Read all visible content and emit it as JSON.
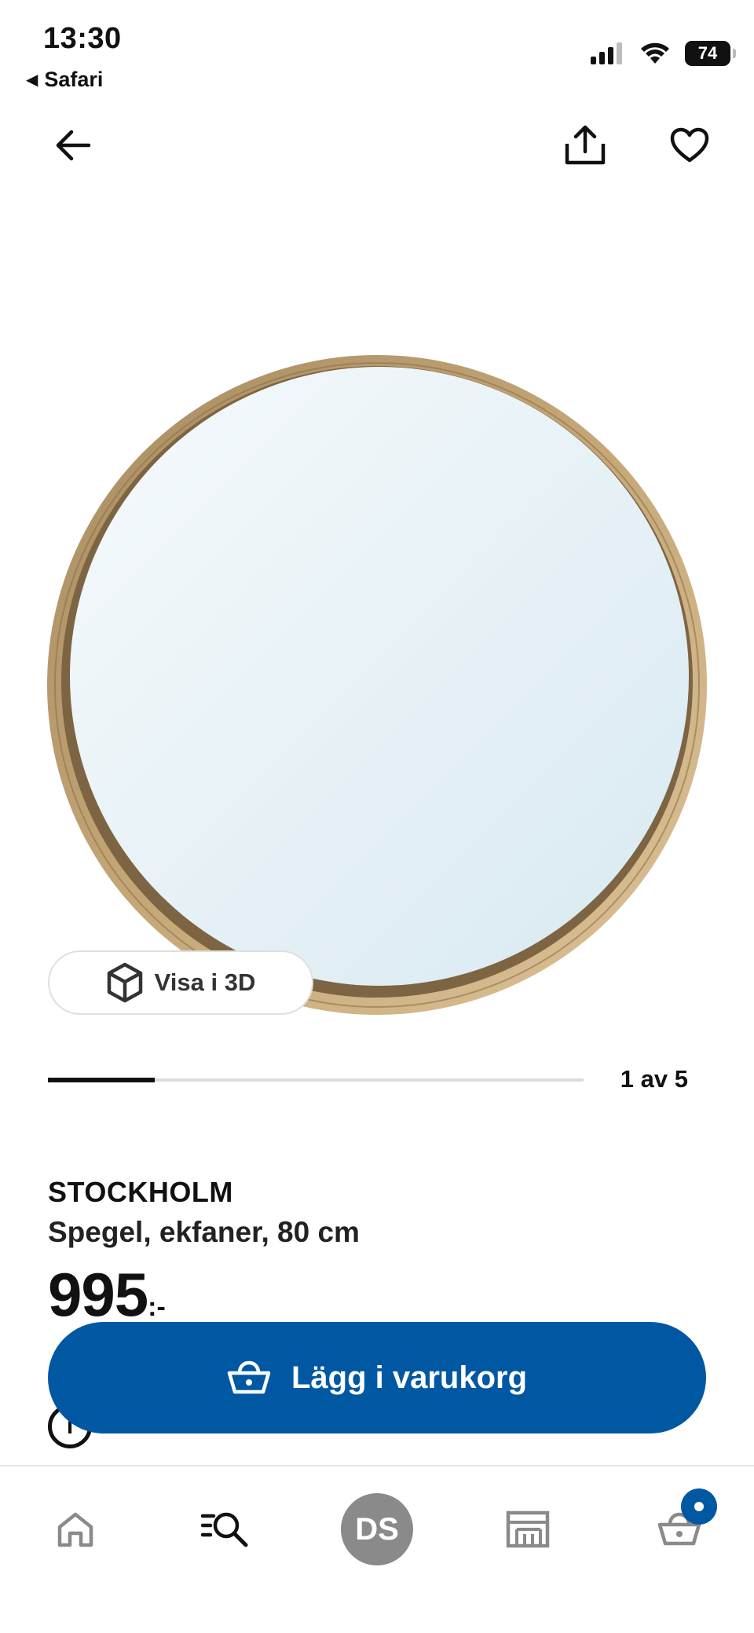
{
  "status_bar": {
    "time": "13:30",
    "back_app": "Safari",
    "battery": "74"
  },
  "product": {
    "name": "STOCKHOLM",
    "description": "Spegel, ekfaner, 80 cm",
    "price": "995",
    "price_suffix": ":-"
  },
  "view3d": {
    "label": "Visa i 3D"
  },
  "gallery": {
    "position_text": "1 av 5",
    "progress": 0.2
  },
  "cart_button": {
    "label": "Lägg i varukorg"
  },
  "tabs": [
    "home",
    "search",
    "profile",
    "store",
    "cart"
  ],
  "profile_initials": "DS",
  "colors": {
    "brand_blue": "#0058a3"
  }
}
